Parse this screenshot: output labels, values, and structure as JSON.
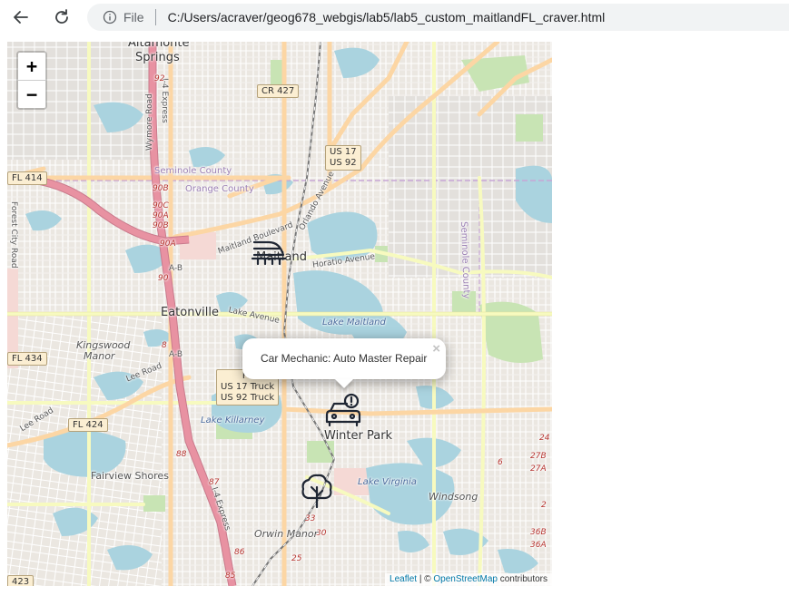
{
  "browser": {
    "file_label": "File",
    "url": "C:/Users/acraver/geog678_webgis/lab5/lab5_custom_maitlandFL_craver.html"
  },
  "map": {
    "zoom_in_label": "+",
    "zoom_out_label": "−",
    "places": {
      "altamonte": "Altamonte",
      "springs": "Springs",
      "maitland": "Maitland",
      "eatonville": "Eatonville",
      "winter_park": "Winter Park",
      "fairview_shores": "Fairview Shores",
      "kingswood": "Kingswood",
      "manor": "Manor",
      "orwin_manor": "Orwin Manor",
      "windsong": "Windsong"
    },
    "water": {
      "lake_maitland": "Lake Maitland",
      "lake_killarney": "Lake Killarney",
      "lake_virginia": "Lake Virginia"
    },
    "roads": {
      "maitland_blvd": "Maitland Boulevard",
      "orlando_ave": "Orlando Avenue",
      "horatio_ave": "Horatio Avenue",
      "lake_ave": "Lake Avenue",
      "lee_road_1": "Lee Road",
      "lee_road_2": "Lee Road",
      "forest_city": "Forest City Road",
      "wymore": "Wymore Road",
      "i4_express_n": "I-4 Express",
      "i4_express_s": "I-4 Express",
      "ab_1": "A-B",
      "ab_2": "A-B",
      "seminole_county_w": "Seminole County",
      "orange_county": "Orange County",
      "seminole_county_e": "Seminole County"
    },
    "shields": {
      "cr427": "CR 427",
      "us17_line1": "US 17",
      "us17_line2": "US 92",
      "fl414": "FL 414",
      "fl434": "FL 434",
      "fl424": "FL 424",
      "truck_line0": "FL",
      "truck_line1": "US 17 Truck",
      "truck_line2": "US 92 Truck",
      "r423": "423"
    },
    "exit_numbers": [
      "92",
      "90B",
      "90C",
      "90A",
      "90B",
      "90A",
      "90",
      "88",
      "87",
      "85",
      "86",
      "33",
      "30",
      "25",
      "24",
      "27B",
      "27A",
      "36B",
      "36A",
      "6",
      "2",
      "8"
    ],
    "markers": [
      {
        "name": "train-station-icon",
        "label": "Train station"
      },
      {
        "name": "car-mechanic-icon",
        "label": "Car Mechanic"
      },
      {
        "name": "park-tree-icon",
        "label": "Park"
      }
    ],
    "popup": {
      "text": "Car Mechanic: Auto Master Repair",
      "close": "×"
    },
    "attribution": {
      "leaflet": "Leaflet",
      "sep": " | © ",
      "osm": "OpenStreetMap",
      "contributors": " contributors"
    },
    "colors": {
      "land": "#f2efe9",
      "water": "#aad3df",
      "motorway": "#e892a2",
      "trunk": "#f9b29c",
      "primary": "#fcd6a4",
      "secondary": "#f7fabf",
      "park": "#add19e",
      "residential": "#e0dfdf"
    }
  }
}
